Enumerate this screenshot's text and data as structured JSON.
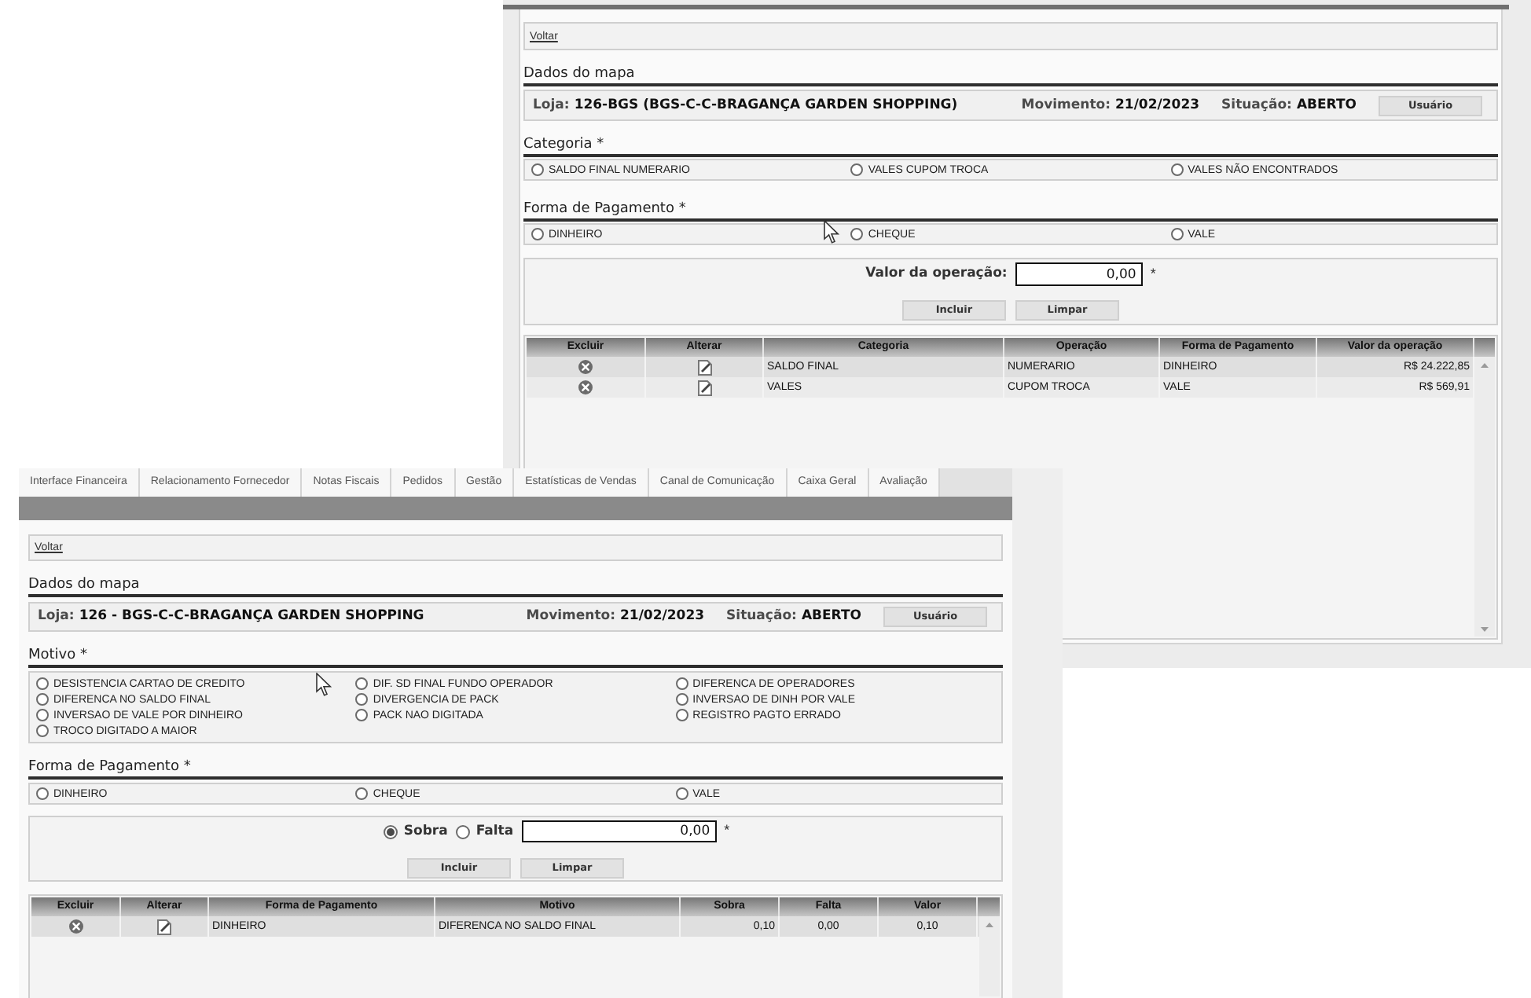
{
  "back_window": {
    "back_link": "Voltar",
    "map_data": {
      "title": "Dados do mapa",
      "fields": [
        {
          "label": "Loja:",
          "value": "126-BGS (BGS-C-C-BRAGANÇA GARDEN SHOPPING)"
        },
        {
          "label": "Movimento:",
          "value": "21/02/2023"
        },
        {
          "label": "Situação:",
          "value": "ABERTO"
        }
      ],
      "user_button": "Usuário"
    },
    "option_groups": [
      {
        "title": "Categoria *",
        "options": [
          {
            "label": "SALDO FINAL NUMERARIO",
            "selected": false
          },
          {
            "label": "VALES CUPOM TROCA",
            "selected": false
          },
          {
            "label": "VALES NÃO ENCONTRADOS",
            "selected": false
          }
        ]
      },
      {
        "title": "Forma de Pagamento *",
        "options": [
          {
            "label": "DINHEIRO",
            "selected": false
          },
          {
            "label": "CHEQUE",
            "selected": false
          },
          {
            "label": "VALE",
            "selected": false
          }
        ]
      }
    ],
    "entry": {
      "kind": "amount",
      "label": "Valor da operação:",
      "value": "0,00",
      "required_mark": "*",
      "buttons": [
        "Incluir",
        "Limpar"
      ]
    },
    "table": {
      "columns": [
        {
          "label": "Excluir",
          "kind": "delete"
        },
        {
          "label": "Alterar",
          "kind": "edit"
        },
        {
          "label": "Categoria",
          "kind": "text"
        },
        {
          "label": "Operação",
          "kind": "text"
        },
        {
          "label": "Forma de Pagamento",
          "kind": "text"
        },
        {
          "label": "Valor da operação",
          "kind": "amount"
        }
      ],
      "rows": [
        {
          "cells": [
            "",
            "",
            "SALDO FINAL",
            "NUMERARIO",
            "DINHEIRO",
            "R$ 24.222,85"
          ]
        },
        {
          "cells": [
            "",
            "",
            "VALES",
            "CUPOM TROCA",
            "VALE",
            "R$ 569,91"
          ]
        }
      ]
    }
  },
  "front_window": {
    "tabs": [
      {
        "label": "Interface Financeira",
        "selected": false
      },
      {
        "label": "Relacionamento Fornecedor",
        "selected": false
      },
      {
        "label": "Notas Fiscais",
        "selected": false
      },
      {
        "label": "Pedidos",
        "selected": false
      },
      {
        "label": "Gestão",
        "selected": false
      },
      {
        "label": "Estatísticas de Vendas",
        "selected": false
      },
      {
        "label": "Canal de Comunicação",
        "selected": false
      },
      {
        "label": "Caixa Geral",
        "selected": false
      },
      {
        "label": "Avaliação",
        "selected": false
      }
    ],
    "back_link": "Voltar",
    "map_data": {
      "title": "Dados do mapa",
      "fields": [
        {
          "label": "Loja:",
          "value": "126 - BGS-C-C-BRAGANÇA GARDEN SHOPPING"
        },
        {
          "label": "Movimento:",
          "value": "21/02/2023"
        },
        {
          "label": "Situação:",
          "value": "ABERTO"
        }
      ],
      "user_button": "Usuário"
    },
    "option_groups": [
      {
        "title": "Motivo *",
        "options": [
          {
            "label": "DESISTENCIA CARTAO DE CREDITO",
            "selected": false
          },
          {
            "label": "DIF. SD FINAL FUNDO OPERADOR",
            "selected": false
          },
          {
            "label": "DIFERENCA DE OPERADORES",
            "selected": false
          },
          {
            "label": "DIFERENCA NO SALDO FINAL",
            "selected": false
          },
          {
            "label": "DIVERGENCIA DE PACK",
            "selected": false
          },
          {
            "label": "INVERSAO DE DINH POR VALE",
            "selected": false
          },
          {
            "label": "INVERSAO DE VALE POR DINHEIRO",
            "selected": false
          },
          {
            "label": "PACK NAO DIGITADA",
            "selected": false
          },
          {
            "label": "REGISTRO PAGTO ERRADO",
            "selected": false
          },
          {
            "label": "TROCO DIGITADO A MAIOR",
            "selected": false
          }
        ]
      },
      {
        "title": "Forma de Pagamento *",
        "options": [
          {
            "label": "DINHEIRO",
            "selected": false
          },
          {
            "label": "CHEQUE",
            "selected": false
          },
          {
            "label": "VALE",
            "selected": false
          }
        ]
      }
    ],
    "entry": {
      "kind": "balance",
      "choices": [
        {
          "label": "Sobra",
          "selected": true
        },
        {
          "label": "Falta",
          "selected": false
        }
      ],
      "value": "0,00",
      "required_mark": "*",
      "buttons": [
        "Incluir",
        "Limpar"
      ]
    },
    "table": {
      "columns": [
        {
          "label": "Excluir",
          "kind": "delete"
        },
        {
          "label": "Alterar",
          "kind": "edit"
        },
        {
          "label": "Forma de Pagamento",
          "kind": "text"
        },
        {
          "label": "Motivo",
          "kind": "text"
        },
        {
          "label": "Sobra",
          "kind": "amount"
        },
        {
          "label": "Falta",
          "kind": "figure"
        },
        {
          "label": "Valor",
          "kind": "figure"
        }
      ],
      "rows": [
        {
          "cells": [
            "",
            "",
            "DINHEIRO",
            "DIFERENCA NO SALDO FINAL",
            "0,10",
            "0,00",
            "0,10"
          ]
        }
      ]
    }
  }
}
